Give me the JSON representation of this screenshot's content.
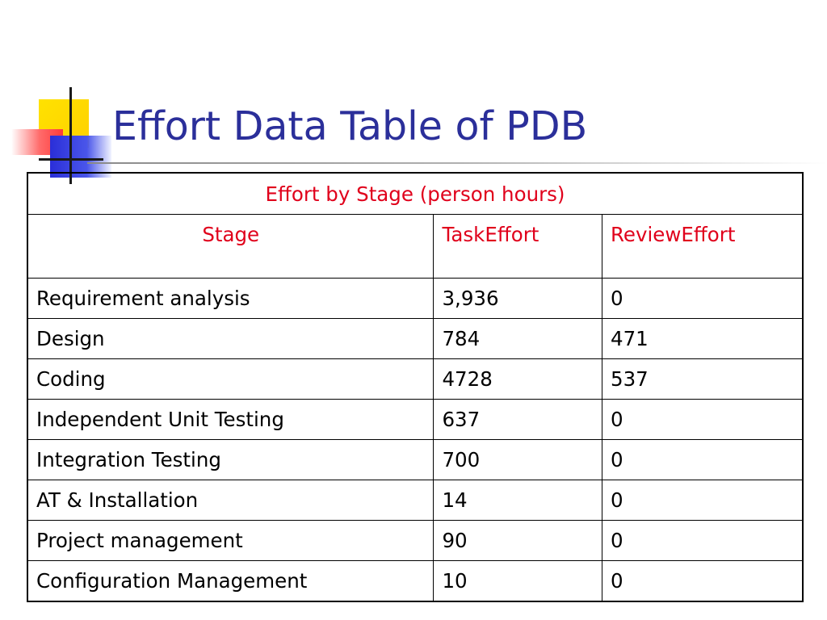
{
  "slide": {
    "title": "Effort Data Table of PDB"
  },
  "table": {
    "caption": "Effort by Stage (person hours)",
    "columns": [
      "Stage",
      "TaskEffort",
      "ReviewEffort"
    ],
    "rows": [
      {
        "stage": "Requirement analysis",
        "task_effort": "3,936",
        "review_effort": "0"
      },
      {
        "stage": "Design",
        "task_effort": "784",
        "review_effort": "471"
      },
      {
        "stage": "Coding",
        "task_effort": "4728",
        "review_effort": "537"
      },
      {
        "stage": "Independent Unit Testing",
        "task_effort": "637",
        "review_effort": "0"
      },
      {
        "stage": "Integration Testing",
        "task_effort": "700",
        "review_effort": "0"
      },
      {
        "stage": "AT & Installation",
        "task_effort": "14",
        "review_effort": "0"
      },
      {
        "stage": "Project management",
        "task_effort": "90",
        "review_effort": "0"
      },
      {
        "stage": "Configuration Management",
        "task_effort": "10",
        "review_effort": "0"
      }
    ]
  },
  "colors": {
    "title": "#2b2f9a",
    "header_text": "#e0001b",
    "body_text": "#000000",
    "logo_yellow": "#ffd000",
    "logo_red": "#ff3a3a",
    "logo_blue": "#2a2ed8"
  }
}
